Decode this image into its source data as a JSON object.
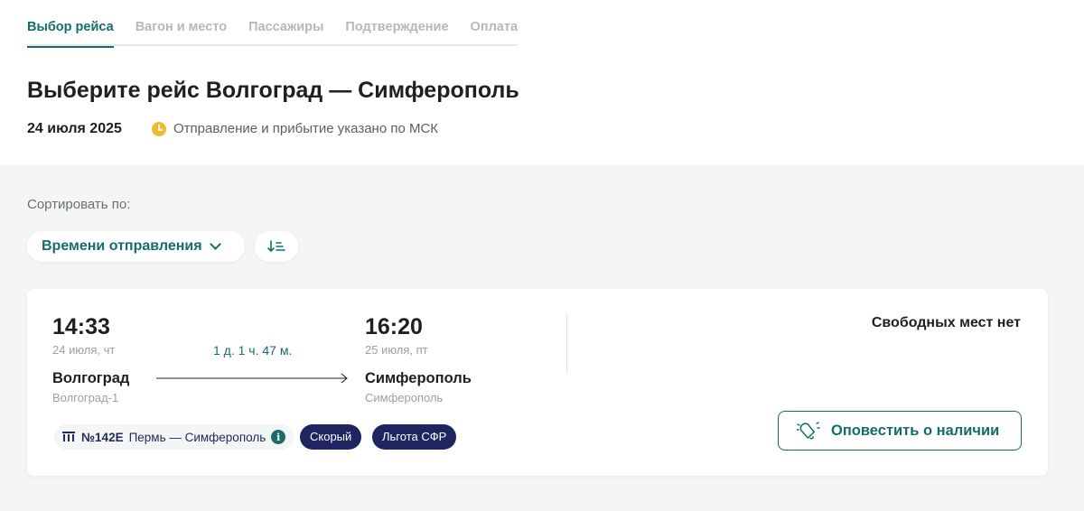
{
  "steps": [
    {
      "label": "Выбор рейса",
      "active": true
    },
    {
      "label": "Вагон и место",
      "active": false
    },
    {
      "label": "Пассажиры",
      "active": false
    },
    {
      "label": "Подтверждение",
      "active": false
    },
    {
      "label": "Оплата",
      "active": false
    }
  ],
  "header": {
    "title": "Выберите рейс Волгоград — Симферополь",
    "date": "24 июля 2025",
    "timezone_note": "Отправление и прибытие указано по МСК",
    "timezone_icon": "clock-icon"
  },
  "sort": {
    "label": "Сортировать по:",
    "selected": "Времени отправления",
    "order_icon": "sort-order-icon"
  },
  "trip": {
    "departure": {
      "time": "14:33",
      "date": "24 июля, чт",
      "city": "Волгоград",
      "station": "Волгоград-1"
    },
    "arrival": {
      "time": "16:20",
      "date": "25 июля, пт",
      "city": "Симферополь",
      "station": "Симферополь"
    },
    "duration": "1 д. 1 ч. 47 м.",
    "train_number": "№142Е",
    "train_route": "Пермь — Симферополь",
    "tags": [
      "Скорый",
      "Льгота СФР"
    ],
    "availability": "Свободных мест нет",
    "notify_label": "Оповестить о наличии"
  },
  "colors": {
    "accent": "#136e6b",
    "badge": "#1f2560",
    "clock": "#f2b82e",
    "background_gray": "#f4f5f5"
  }
}
